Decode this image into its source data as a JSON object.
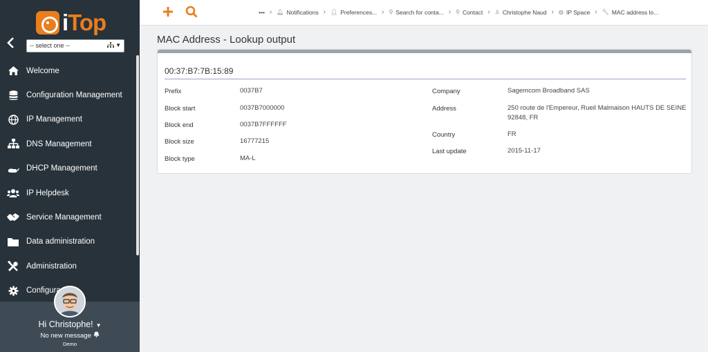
{
  "app": {
    "logo_text": "iTop"
  },
  "sidebar": {
    "org_select": {
      "value": "-- select one --"
    },
    "menu": [
      {
        "label": "Welcome",
        "icon": "home-icon"
      },
      {
        "label": "Configuration Management",
        "icon": "database-icon"
      },
      {
        "label": "IP Management",
        "icon": "globe-icon"
      },
      {
        "label": "DNS Management",
        "icon": "sitemap-icon"
      },
      {
        "label": "DHCP Management",
        "icon": "hand-icon"
      },
      {
        "label": "IP Helpdesk",
        "icon": "users-icon"
      },
      {
        "label": "Service Management",
        "icon": "handshake-icon"
      },
      {
        "label": "Data administration",
        "icon": "folder-icon"
      },
      {
        "label": "Administration",
        "icon": "tools-icon"
      },
      {
        "label": "Configura",
        "icon": "gear-icon"
      }
    ],
    "user": {
      "greeting": "Hi Christophe!",
      "messages": "No new message",
      "organization": "Demo"
    }
  },
  "topbar": {
    "breadcrumb": [
      {
        "label": "•••",
        "icon": ""
      },
      {
        "label": "Notifications",
        "icon": "bell-icon"
      },
      {
        "label": "Preferences...",
        "icon": "user-cog-icon"
      },
      {
        "label": "Search for conta...",
        "icon": "search-icon"
      },
      {
        "label": "Contact",
        "icon": "search-icon"
      },
      {
        "label": "Christophe Naud",
        "icon": "person-icon"
      },
      {
        "label": "IP Space",
        "icon": "globe-icon"
      },
      {
        "label": "MAC address lo...",
        "icon": "wrench-icon"
      }
    ]
  },
  "main": {
    "page_title": "MAC Address - Lookup output",
    "mac": "00:37:B7:7B:15:89",
    "left_fields": [
      {
        "label": "Prefix",
        "value": "0037B7"
      },
      {
        "label": "Block start",
        "value": "0037B7000000"
      },
      {
        "label": "Block end",
        "value": "0037B7FFFFFF"
      },
      {
        "label": "Block size",
        "value": "16777215"
      },
      {
        "label": "Block type",
        "value": "MA-L"
      }
    ],
    "right_fields": [
      {
        "label": "Company",
        "value": "Sagemcom Broadband SAS"
      },
      {
        "label": "Address",
        "value": "250 route de l'Empereur, Rueil Malmaison HAUTS DE SEINE 92848, FR"
      },
      {
        "label": "Country",
        "value": "FR"
      },
      {
        "label": "Last update",
        "value": "2015-11-17"
      }
    ]
  },
  "colors": {
    "accent": "#ea7d1e",
    "sidebar_bg": "#27323a",
    "user_panel_bg": "#3e4b55"
  }
}
